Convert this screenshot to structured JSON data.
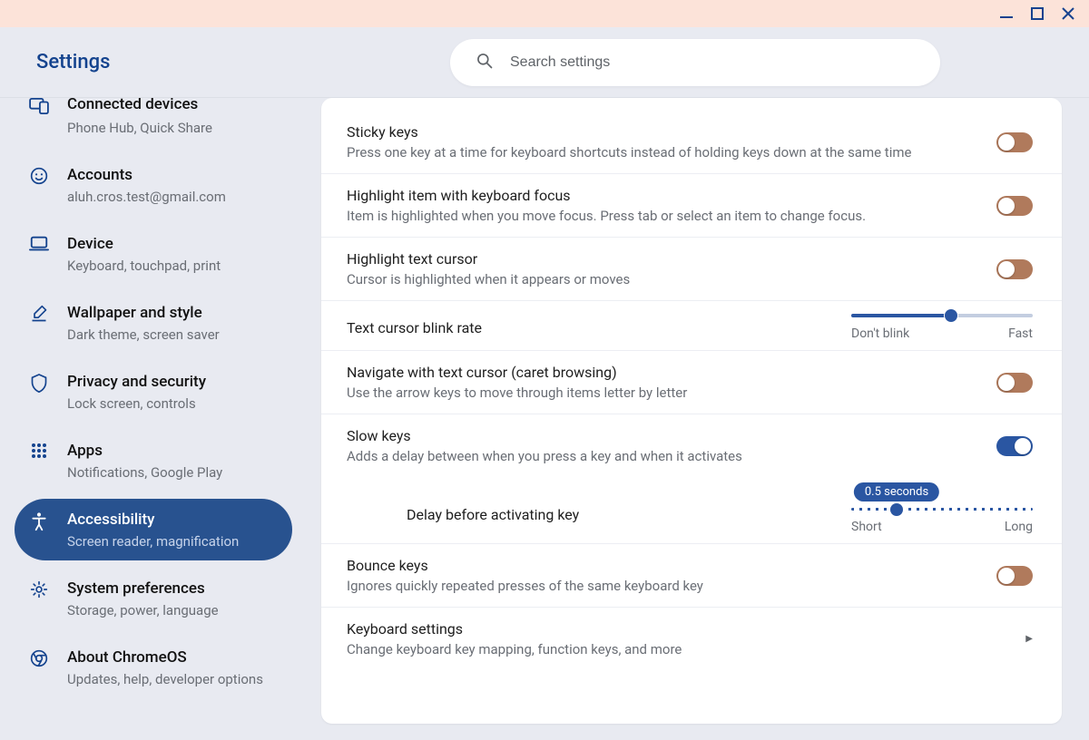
{
  "window": {
    "title": "Settings"
  },
  "header": {
    "title": "Settings"
  },
  "search": {
    "placeholder": "Search settings"
  },
  "sidebar": {
    "items": [
      {
        "label": "Connected devices",
        "sub": "Phone Hub, Quick Share",
        "icon": "devices"
      },
      {
        "label": "Accounts",
        "sub": "aluh.cros.test@gmail.com",
        "icon": "face"
      },
      {
        "label": "Device",
        "sub": "Keyboard, touchpad, print",
        "icon": "laptop"
      },
      {
        "label": "Wallpaper and style",
        "sub": "Dark theme, screen saver",
        "icon": "palette"
      },
      {
        "label": "Privacy and security",
        "sub": "Lock screen, controls",
        "icon": "shield"
      },
      {
        "label": "Apps",
        "sub": "Notifications, Google Play",
        "icon": "apps"
      },
      {
        "label": "Accessibility",
        "sub": "Screen reader, magnification",
        "icon": "a11y",
        "active": true
      },
      {
        "label": "System preferences",
        "sub": "Storage, power, language",
        "icon": "gear"
      },
      {
        "label": "About ChromeOS",
        "sub": "Updates, help, developer options",
        "icon": "chrome"
      }
    ]
  },
  "main": {
    "rows": [
      {
        "title": "Sticky keys",
        "desc": "Press one key at a time for keyboard shortcuts instead of holding keys down at the same time",
        "toggle": false
      },
      {
        "title": "Highlight item with keyboard focus",
        "desc": "Item is highlighted when you move focus. Press tab or select an item to change focus.",
        "toggle": false
      },
      {
        "title": "Highlight text cursor",
        "desc": "Cursor is highlighted when it appears or moves",
        "toggle": false
      }
    ],
    "blink_rate": {
      "title": "Text cursor blink rate",
      "left": "Don't blink",
      "right": "Fast",
      "percent": 55
    },
    "caret": {
      "title": "Navigate with text cursor (caret browsing)",
      "desc": "Use the arrow keys to move through items letter by letter",
      "toggle": false
    },
    "slow_keys": {
      "title": "Slow keys",
      "desc": "Adds a delay between when you press a key and when it activates",
      "toggle": true
    },
    "slow_delay": {
      "title": "Delay before activating key",
      "left": "Short",
      "right": "Long",
      "bubble": "0.5 seconds",
      "percent": 25
    },
    "bounce": {
      "title": "Bounce keys",
      "desc": "Ignores quickly repeated presses of the same keyboard key",
      "toggle": false
    },
    "keyboard_settings": {
      "title": "Keyboard settings",
      "desc": "Change keyboard key mapping, function keys, and more"
    }
  }
}
